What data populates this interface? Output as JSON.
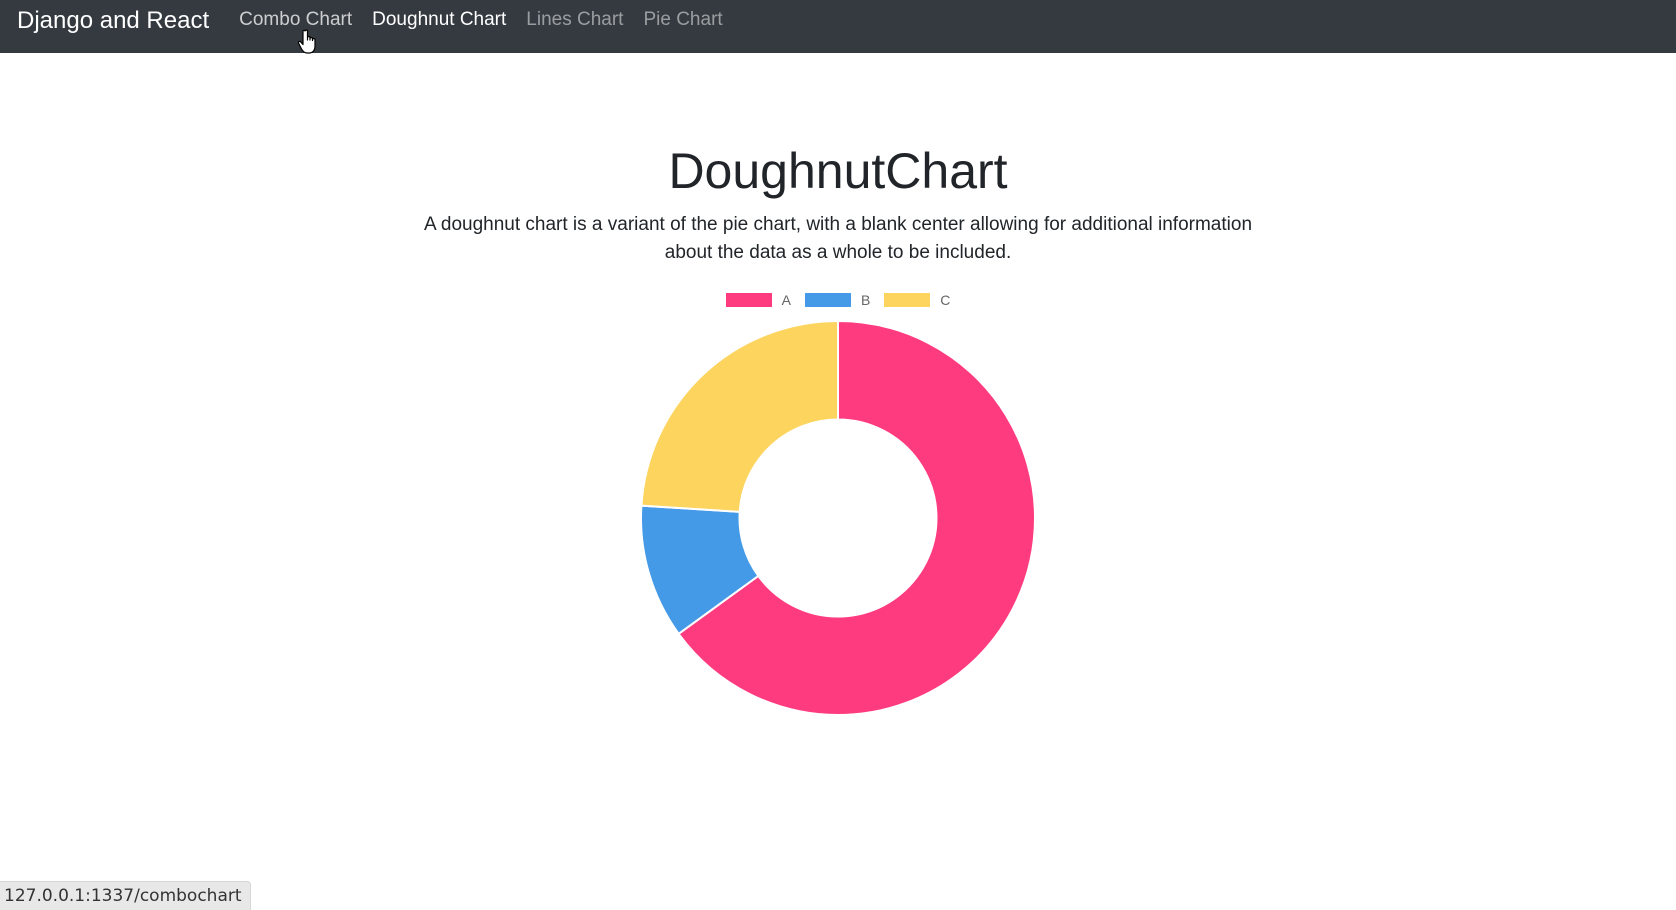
{
  "navbar": {
    "brand": "Django and React",
    "links": [
      {
        "label": "Combo Chart",
        "state": "hover"
      },
      {
        "label": "Doughnut Chart",
        "state": "active"
      },
      {
        "label": "Lines Chart",
        "state": "normal"
      },
      {
        "label": "Pie Chart",
        "state": "normal"
      }
    ]
  },
  "main": {
    "title": "DoughnutChart",
    "description": "A doughnut chart is a variant of the pie chart, with a blank center allowing for additional information about the data as a whole to be included."
  },
  "chart_data": {
    "type": "pie",
    "variant": "doughnut",
    "categories": [
      "A",
      "B",
      "C"
    ],
    "values": [
      65,
      11,
      24
    ],
    "colors": [
      "#ff3b80",
      "#459ae8",
      "#fcd45e"
    ],
    "legend_position": "top",
    "cutout_ratio": 0.5
  },
  "status_bar": {
    "url": "127.0.0.1:1337/combochart"
  },
  "cursor": {
    "icon": "hand-pointer-icon"
  }
}
